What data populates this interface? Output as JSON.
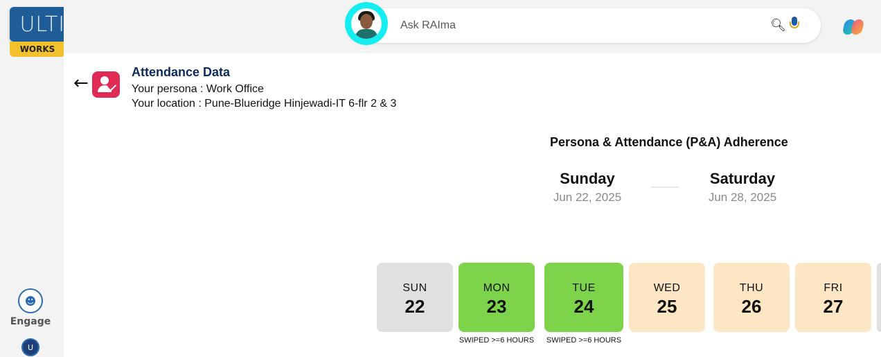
{
  "logo": {
    "text": "ULTIMA",
    "tag": "WORKS"
  },
  "sidebar": {
    "items": [
      {
        "label": "Engage",
        "icon": "engage-icon"
      },
      {
        "label": "",
        "icon": "ultima-network-icon"
      }
    ]
  },
  "search": {
    "placeholder": "Ask RAIma",
    "avatar": "raima-avatar"
  },
  "page": {
    "title": "Attendance Data",
    "persona_line": "Your persona : Work Office",
    "location_line": "Your location : Pune-Blueridge Hinjewadi-IT 6-flr 2 & 3"
  },
  "adherence": {
    "title": "Persona & Attendance (P&A) Adherence",
    "start": {
      "day": "Sunday",
      "date": "Jun 22, 2025"
    },
    "end": {
      "day": "Saturday",
      "date": "Jun 28, 2025"
    }
  },
  "days": [
    {
      "name": "SUN",
      "num": "22",
      "status": "",
      "color": "#e0e0e0"
    },
    {
      "name": "MON",
      "num": "23",
      "status": "SWIPED >=6 HOURS",
      "color": "#7dd34a"
    },
    {
      "name": "TUE",
      "num": "24",
      "status": "SWIPED >=6 HOURS",
      "color": "#7dd34a"
    },
    {
      "name": "WED",
      "num": "25",
      "status": "",
      "color": "#fde6c4"
    },
    {
      "name": "THU",
      "num": "26",
      "status": "",
      "color": "#fde6c4"
    },
    {
      "name": "FRI",
      "num": "27",
      "status": "",
      "color": "#fde6c4"
    }
  ],
  "colors": {
    "brand": "#1f5d99",
    "accent": "#f2c12e",
    "attendance_icon": "#e02a55",
    "avatar_ring": "#15eef0"
  }
}
